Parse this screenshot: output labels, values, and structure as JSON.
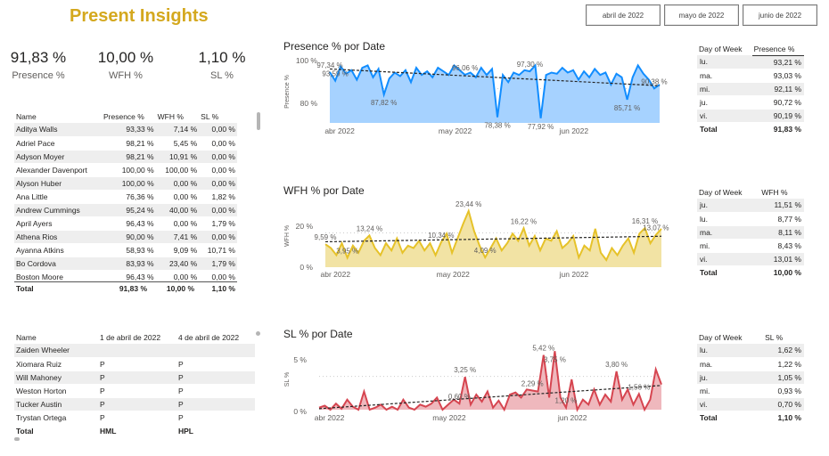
{
  "title": "Present Insights",
  "slicers": [
    "abril de 2022",
    "mayo de 2022",
    "junio de 2022"
  ],
  "kpis": [
    {
      "value": "91,83 %",
      "label": "Presence %"
    },
    {
      "value": "10,00 %",
      "label": "WFH %"
    },
    {
      "value": "1,10 %",
      "label": "SL %"
    }
  ],
  "emp_table": {
    "headers": [
      "Name",
      "Presence %",
      "WFH %",
      "SL %"
    ],
    "rows": [
      [
        "Aditya Walls",
        "93,33 %",
        "7,14 %",
        "0,00 %"
      ],
      [
        "Adriel Pace",
        "98,21 %",
        "5,45 %",
        "0,00 %"
      ],
      [
        "Adyson Moyer",
        "98,21 %",
        "10,91 %",
        "0,00 %"
      ],
      [
        "Alexander Davenport",
        "100,00 %",
        "100,00 %",
        "0,00 %"
      ],
      [
        "Alyson Huber",
        "100,00 %",
        "0,00 %",
        "0,00 %"
      ],
      [
        "Ana Little",
        "76,36 %",
        "0,00 %",
        "1,82 %"
      ],
      [
        "Andrew Cummings",
        "95,24 %",
        "40,00 %",
        "0,00 %"
      ],
      [
        "April Ayers",
        "96,43 %",
        "0,00 %",
        "1,79 %"
      ],
      [
        "Athena Rios",
        "90,00 %",
        "7,41 %",
        "0,00 %"
      ],
      [
        "Ayanna Atkins",
        "58,93 %",
        "9,09 %",
        "10,71 %"
      ],
      [
        "Bo Cordova",
        "83,93 %",
        "23,40 %",
        "1,79 %"
      ],
      [
        "Boston Moore",
        "96,43 %",
        "0,00 %",
        "0,00 %"
      ]
    ],
    "total": [
      "Total",
      "91,83 %",
      "10,00 %",
      "1,10 %"
    ]
  },
  "attendance_table": {
    "headers": [
      "Name",
      "1 de abril de 2022",
      "4 de abril de 2022"
    ],
    "rows": [
      [
        "Zaiden Wheeler",
        "",
        ""
      ],
      [
        "Xiomara Ruiz",
        "P",
        "P"
      ],
      [
        "Will Mahoney",
        "P",
        "P"
      ],
      [
        "Weston Horton",
        "P",
        "P"
      ],
      [
        "Tucker Austin",
        "P",
        "P"
      ],
      [
        "Trystan Ortega",
        "P",
        "P"
      ]
    ],
    "total": [
      "Total",
      "HML",
      "HPL"
    ]
  },
  "dow_presence": {
    "headers": [
      "Day of Week",
      "Presence %"
    ],
    "rows": [
      [
        "lu.",
        "93,21 %"
      ],
      [
        "ma.",
        "93,03 %"
      ],
      [
        "mi.",
        "92,11 %"
      ],
      [
        "ju.",
        "90,72 %"
      ],
      [
        "vi.",
        "90,19 %"
      ]
    ],
    "total": [
      "Total",
      "91,83 %"
    ]
  },
  "dow_wfh": {
    "headers": [
      "Day of Week",
      "WFH %"
    ],
    "rows": [
      [
        "ju.",
        "11,51 %"
      ],
      [
        "lu.",
        "8,77 %"
      ],
      [
        "ma.",
        "8,11 %"
      ],
      [
        "mi.",
        "8,43 %"
      ],
      [
        "vi.",
        "13,01 %"
      ]
    ],
    "total": [
      "Total",
      "10,00 %"
    ]
  },
  "dow_sl": {
    "headers": [
      "Day of Week",
      "SL %"
    ],
    "rows": [
      [
        "lu.",
        "1,62 %"
      ],
      [
        "ma.",
        "1,22 %"
      ],
      [
        "ju.",
        "1,05 %"
      ],
      [
        "mi.",
        "0,93 %"
      ],
      [
        "vi.",
        "0,70 %"
      ]
    ],
    "total": [
      "Total",
      "1,10 %"
    ]
  },
  "colors": {
    "presence": "#118DFF",
    "presence_fill": "#A6D2FF",
    "wfh": "#E6C229",
    "wfh_fill": "#F2E3A4",
    "sl": "#D64550",
    "sl_fill": "#EFB8BD",
    "title": "#D4A81E"
  },
  "chart_data": [
    {
      "type": "area",
      "title": "Presence % por Date",
      "ylabel": "Presence %",
      "x_ticks": [
        "abr 2022",
        "may 2022",
        "jun 2022"
      ],
      "y_ticks": [
        "100 %",
        "80 %"
      ],
      "ylim": [
        76,
        102
      ],
      "values": [
        97.2,
        93.6,
        99.6,
        96.5,
        98.0,
        94.0,
        99.0,
        100,
        95.0,
        98.5,
        87.82,
        94.5,
        97.0,
        95.5,
        98.0,
        93.0,
        99.0,
        96.0,
        97.5,
        95.0,
        99.0,
        97.5,
        96.0,
        100,
        98.0,
        96.06,
        97.0,
        95.0,
        99.0,
        96.0,
        98.5,
        78.38,
        96.0,
        93.0,
        97.0,
        96.0,
        98.0,
        97.5,
        100,
        77.92,
        96.0,
        97.0,
        96.5,
        99.0,
        97.0,
        98.0,
        94.0,
        97.5,
        95.0,
        98.5,
        96.0,
        97.0,
        92.0,
        96.5,
        95.0,
        85.71,
        95.0,
        100,
        96.5,
        94.0,
        90.38,
        92.0
      ],
      "trend": [
        98.5,
        91.5
      ],
      "labels": [
        [
          "97,34 %",
          0
        ],
        [
          "93,59 %",
          1
        ],
        [
          "87,82 %",
          10
        ],
        [
          "96,06 %",
          25
        ],
        [
          "97,30 %",
          37
        ],
        [
          "78,38 %",
          31
        ],
        [
          "77,92 %",
          39
        ],
        [
          "85,71 %",
          55
        ],
        [
          "90,38 %",
          60
        ]
      ]
    },
    {
      "type": "area",
      "title": "WFH % por Date",
      "ylabel": "WFH %",
      "x_ticks": [
        "abr 2022",
        "may 2022",
        "jun 2022"
      ],
      "y_ticks": [
        "20 %",
        "0 %"
      ],
      "ylim": [
        0,
        26
      ],
      "values": [
        9.59,
        8.0,
        5.0,
        10.0,
        3.95,
        9.0,
        6.0,
        11.0,
        13.24,
        8.0,
        5.0,
        10.0,
        7.0,
        12.0,
        6.0,
        9.0,
        8.0,
        11.0,
        7.0,
        10.0,
        5.0,
        10.34,
        14.0,
        6.0,
        12.0,
        18.0,
        23.44,
        15.0,
        9.0,
        4.09,
        8.0,
        12.0,
        7.0,
        10.0,
        14.0,
        11.0,
        16.22,
        9.0,
        13.0,
        7.0,
        12.0,
        11.0,
        15.0,
        8.0,
        10.0,
        13.0,
        4.0,
        9.0,
        7.0,
        16.0,
        6.0,
        3.0,
        8.0,
        5.0,
        9.0,
        12.0,
        6.0,
        14.0,
        16.31,
        10.0,
        13.5,
        16.0
      ],
      "trend": [
        10.6,
        12.9
      ],
      "labels": [
        [
          "9,59 %",
          0
        ],
        [
          "3,95 %",
          4
        ],
        [
          "13,24 %",
          8
        ],
        [
          "10,34 %",
          21
        ],
        [
          "23,44 %",
          26
        ],
        [
          "4,09 %",
          29
        ],
        [
          "16,22 %",
          36
        ],
        [
          "16,31 %",
          58
        ],
        [
          "13,07 %",
          60
        ]
      ]
    },
    {
      "type": "area",
      "title": "SL % por Date",
      "ylabel": "SL %",
      "x_ticks": [
        "abr 2022",
        "may 2022",
        "jun 2022"
      ],
      "y_ticks": [
        "5 %",
        "0 %"
      ],
      "ylim": [
        0,
        6
      ],
      "values": [
        0.2,
        0.4,
        0.0,
        0.6,
        0.1,
        1.0,
        0.3,
        0.0,
        1.8,
        0.0,
        0.2,
        0.5,
        0.0,
        0.3,
        0.0,
        1.0,
        0.2,
        0.0,
        0.5,
        0.3,
        0.6,
        1.2,
        0.0,
        0.5,
        1.0,
        0.6,
        3.25,
        0.5,
        1.5,
        0.8,
        1.8,
        0.2,
        0.9,
        0.0,
        1.5,
        1.7,
        1.2,
        2.0,
        1.9,
        1.8,
        5.42,
        1.2,
        5.8,
        1.2,
        0.2,
        3.0,
        0.0,
        1.0,
        0.5,
        2.0,
        0.5,
        1.5,
        0.8,
        3.8,
        1.0,
        2.0,
        0.5,
        1.56,
        0.0,
        1.0,
        4.0,
        2.5
      ],
      "trend": [
        0.1,
        2.4
      ],
      "labels": [
        [
          "0,60 %",
          25
        ],
        [
          "3,25 %",
          26
        ],
        [
          "5,42 %",
          40
        ],
        [
          "3,75 %",
          42
        ],
        [
          "2,29 %",
          38
        ],
        [
          "1,20 %",
          44
        ],
        [
          "3,80 %",
          53
        ],
        [
          "1,56 %",
          57
        ]
      ]
    }
  ]
}
